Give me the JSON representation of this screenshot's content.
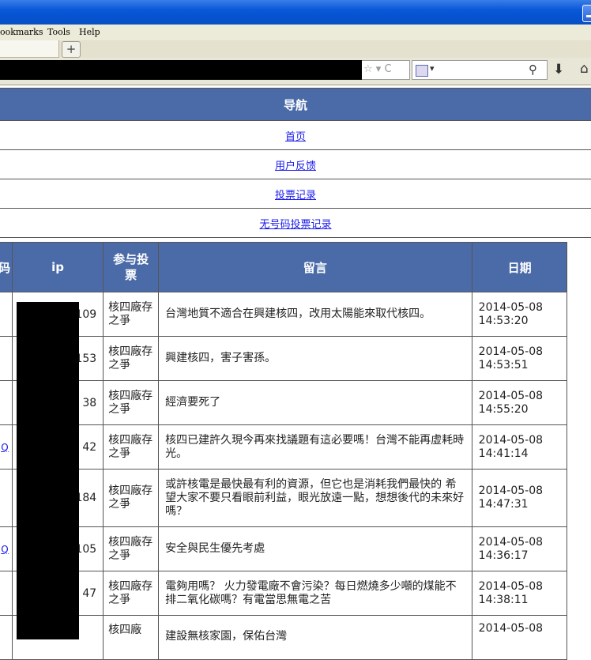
{
  "browser": {
    "menu": [
      "ookmarks",
      "Tools",
      "Help"
    ],
    "newtab_label": "+",
    "url_icons": "☆ ▾ C",
    "search_engine_caret": "▾"
  },
  "nav": {
    "title": "导航",
    "links": [
      "首页",
      "用户反馈",
      "投票记录",
      "无号码投票记录"
    ]
  },
  "table": {
    "headers": [
      "码",
      "ip",
      "参与投票",
      "留言",
      "日期"
    ],
    "rows": [
      {
        "name": "",
        "ip": "109",
        "vote": "核四廠存之爭",
        "message": "台灣地質不適合在興建核四，改用太陽能來取代核四。",
        "date": "2014-05-08 14:53:20"
      },
      {
        "name": "",
        "ip": ".153",
        "vote": "核四廠存之爭",
        "message": "興建核四，害子害孫。",
        "date": "2014-05-08 14:53:51"
      },
      {
        "name": "",
        "ip": "38",
        "vote": "核四廠存之爭",
        "message": "經濟要死了",
        "date": "2014-05-08 14:55:20"
      },
      {
        "name": "Q",
        "ip": "42",
        "vote": "核四廠存之爭",
        "message": "核四已建許久現今再來找議題有這必要嗎！台灣不能再虛耗時光。",
        "date": "2014-05-08 14:41:14"
      },
      {
        "name": "",
        "ip": ".184",
        "vote": "核四廠存之爭",
        "message": "或許核電是最快最有利的資源，但它也是消耗我們最快的 希望大家不要只看眼前利益，眼光放遠一點，想想後代的未來好嗎？",
        "date": "2014-05-08 14:47:31"
      },
      {
        "name": "Q",
        "ip": ".105",
        "vote": "核四廠存之爭",
        "message": "安全與民生優先考處",
        "date": "2014-05-08 14:36:17"
      },
      {
        "name": "",
        "ip": "47",
        "vote": "核四廠存之爭",
        "message": "電夠用嗎？ 火力發電廠不會污染？每日燃燒多少噸的煤能不排二氧化碳嗎？有電當思無電之苦",
        "date": "2014-05-08 14:38:11"
      },
      {
        "name": "",
        "ip": "",
        "vote": "核四廠",
        "message": "建設無核家園，保佑台灣",
        "date": "2014-05-08"
      }
    ]
  }
}
